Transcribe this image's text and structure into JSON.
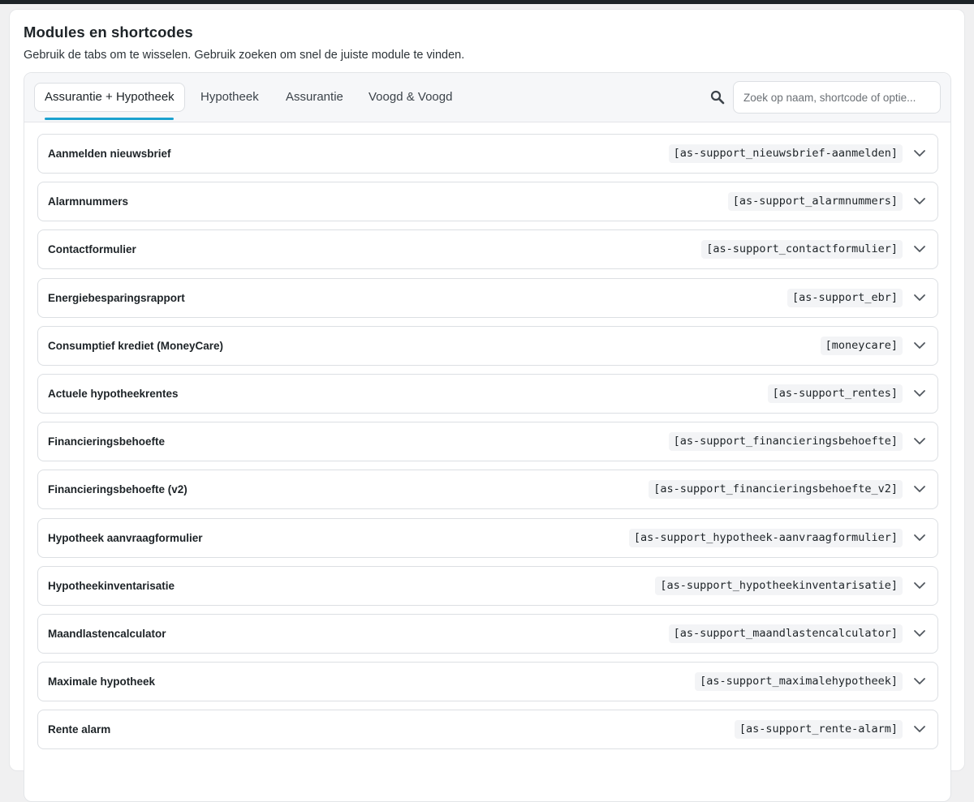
{
  "header": {
    "title": "Modules en shortcodes",
    "description": "Gebruik de tabs om te wisselen. Gebruik zoeken om snel de juiste module te vinden."
  },
  "tabs": [
    {
      "label": "Assurantie + Hypotheek",
      "active": true
    },
    {
      "label": "Hypotheek",
      "active": false
    },
    {
      "label": "Assurantie",
      "active": false
    },
    {
      "label": "Voogd & Voogd",
      "active": false
    }
  ],
  "search": {
    "icon": "search-icon",
    "placeholder": "Zoek op naam, shortcode of optie...",
    "value": ""
  },
  "colors": {
    "accent": "#1ba1cf",
    "background": "#f0f0f1",
    "card": "#ffffff",
    "code_background": "#f3f4f6"
  },
  "modules": [
    {
      "name": "Aanmelden nieuwsbrief",
      "shortcode": "[as-support_nieuwsbrief-aanmelden]"
    },
    {
      "name": "Alarmnummers",
      "shortcode": "[as-support_alarmnummers]"
    },
    {
      "name": "Contactformulier",
      "shortcode": "[as-support_contactformulier]"
    },
    {
      "name": "Energiebesparingsrapport",
      "shortcode": "[as-support_ebr]"
    },
    {
      "name": "Consumptief krediet (MoneyCare)",
      "shortcode": "[moneycare]"
    },
    {
      "name": "Actuele hypotheekrentes",
      "shortcode": "[as-support_rentes]"
    },
    {
      "name": "Financieringsbehoefte",
      "shortcode": "[as-support_financieringsbehoefte]"
    },
    {
      "name": "Financieringsbehoefte (v2)",
      "shortcode": "[as-support_financieringsbehoefte_v2]"
    },
    {
      "name": "Hypotheek aanvraagformulier",
      "shortcode": "[as-support_hypotheek-aanvraagformulier]"
    },
    {
      "name": "Hypotheekinventarisatie",
      "shortcode": "[as-support_hypotheekinventarisatie]"
    },
    {
      "name": "Maandlastencalculator",
      "shortcode": "[as-support_maandlastencalculator]"
    },
    {
      "name": "Maximale hypotheek",
      "shortcode": "[as-support_maximalehypotheek]"
    },
    {
      "name": "Rente alarm",
      "shortcode": "[as-support_rente-alarm]"
    }
  ]
}
